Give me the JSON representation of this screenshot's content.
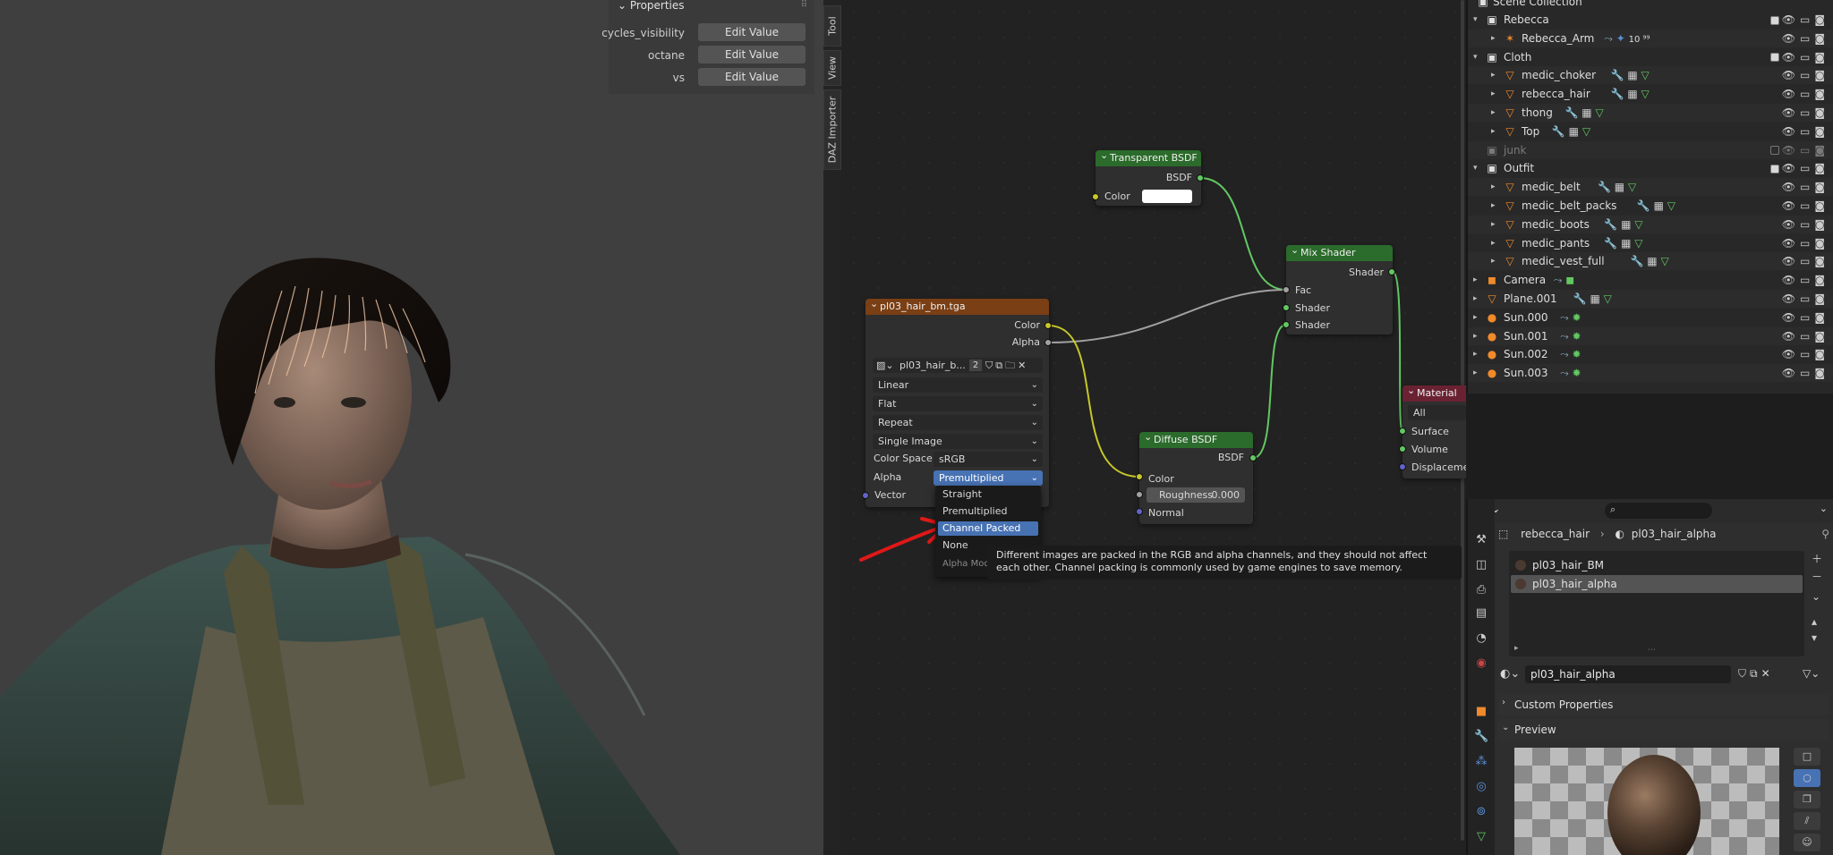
{
  "viewport": {
    "properties_panel": {
      "title": "Properties",
      "rows": [
        {
          "label": "cycles_visibility",
          "button": "Edit Value"
        },
        {
          "label": "octane",
          "button": "Edit Value"
        },
        {
          "label": "vs",
          "button": "Edit Value"
        }
      ]
    }
  },
  "side_tabs": [
    "Tool",
    "View",
    "DAZ Importer"
  ],
  "nodes": {
    "image": {
      "title": "pl03_hair_bm.tga",
      "outputs": [
        "Color",
        "Alpha"
      ],
      "image_name": "pl03_hair_b...",
      "users": "2",
      "interpolation": "Linear",
      "projection": "Flat",
      "extension": "Repeat",
      "source": "Single Image",
      "color_space_label": "Color Space",
      "color_space": "sRGB",
      "alpha_label": "Alpha",
      "alpha": "Premultiplied",
      "input": "Vector"
    },
    "transparent": {
      "title": "Transparent BSDF",
      "output": "BSDF",
      "input": "Color"
    },
    "mix": {
      "title": "Mix Shader",
      "output": "Shader",
      "inputs": [
        "Fac",
        "Shader",
        "Shader"
      ]
    },
    "diffuse": {
      "title": "Diffuse BSDF",
      "output": "BSDF",
      "color": "Color",
      "roughness_label": "Roughness",
      "roughness_value": "0.000",
      "normal": "Normal"
    },
    "output": {
      "title": "Material Ou",
      "target": "All",
      "inputs": [
        "Surface",
        "Volume",
        "Displacement"
      ]
    }
  },
  "alpha_dropdown": {
    "options": [
      "Straight",
      "Premultiplied",
      "Channel Packed",
      "None"
    ],
    "selected": "Channel Packed",
    "hint": "Alpha Mode"
  },
  "tooltip": "Different images are packed in the RGB and alpha channels, and they should not affect each other. Channel packing is commonly used by game engines to save memory.",
  "outliner": {
    "root": "Scene Collection",
    "rows": [
      {
        "name": "Rebecca",
        "type": "collection",
        "level": 0
      },
      {
        "name": "Rebecca_Arm",
        "type": "armature",
        "level": 1,
        "extra": "10 ⁹⁹"
      },
      {
        "name": "Cloth",
        "type": "collection",
        "level": 0
      },
      {
        "name": "medic_choker",
        "type": "mesh",
        "level": 1
      },
      {
        "name": "rebecca_hair",
        "type": "mesh",
        "level": 1
      },
      {
        "name": "thong",
        "type": "mesh",
        "level": 1
      },
      {
        "name": "Top",
        "type": "mesh",
        "level": 1
      },
      {
        "name": "junk",
        "type": "collection",
        "level": 0
      },
      {
        "name": "Outfit",
        "type": "collection",
        "level": 0
      },
      {
        "name": "medic_belt",
        "type": "mesh",
        "level": 1
      },
      {
        "name": "medic_belt_packs",
        "type": "mesh",
        "level": 1
      },
      {
        "name": "medic_boots",
        "type": "mesh",
        "level": 1
      },
      {
        "name": "medic_pants",
        "type": "mesh",
        "level": 1
      },
      {
        "name": "medic_vest_full",
        "type": "mesh",
        "level": 1
      },
      {
        "name": "Camera",
        "type": "camera",
        "level": 0
      },
      {
        "name": "Plane.001",
        "type": "mesh",
        "level": 0
      },
      {
        "name": "Sun.000",
        "type": "light",
        "level": 0
      },
      {
        "name": "Sun.001",
        "type": "light",
        "level": 0
      },
      {
        "name": "Sun.002",
        "type": "light",
        "level": 0
      },
      {
        "name": "Sun.003",
        "type": "light",
        "level": 0
      }
    ]
  },
  "properties_editor": {
    "breadcrumb_object": "rebecca_hair",
    "breadcrumb_material": "pl03_hair_alpha",
    "materials": [
      "pl03_hair_BM",
      "pl03_hair_alpha"
    ],
    "selected_material": "pl03_hair_alpha",
    "material_field": "pl03_hair_alpha",
    "panels": [
      "Custom Properties",
      "Preview"
    ]
  },
  "colors": {
    "accent": "#4772b3",
    "image_header": "#7a3f14",
    "shader_header": "#2b6b2b",
    "output_header": "#6a2233",
    "shader_socket": "#63c763",
    "color_socket": "#c7c729",
    "gray_socket": "#a1a1a1",
    "vector_socket": "#6363c7",
    "annotation_arrow": "#e01818"
  }
}
